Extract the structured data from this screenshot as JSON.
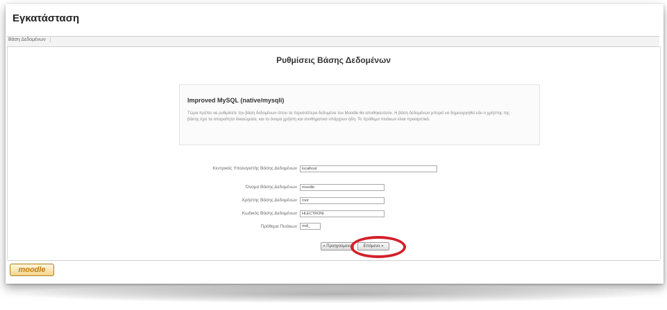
{
  "page": {
    "title": "Εγκατάσταση",
    "breadcrumb": "Βάση Δεδομένων",
    "heading": "Ρυθμίσεις Βάσης Δεδομένων"
  },
  "info": {
    "title": "Improved MySQL (native/mysqli)",
    "text": "Τώρα πρέπει να ρυθμίσετε την βάση δεδομένων όπου τα περισσότερα δεδομένα του Moodle θα αποθηκευτούν. Η βάση δεδομένων μπορεί να δημιουργηθεί εάν ο χρήστης της βάσης έχει τα απαραίτητα δικαιώματα, και το όνομα χρήστη και συνθηματικό υπάρχουν ήδη. Το πρόθεμα πινάκων είναι προαιρετικό."
  },
  "form": {
    "fields": [
      {
        "label": "Κεντρικός Υπολογιστής Βάσης Δεδομένων",
        "value": "localhost"
      },
      {
        "label": "Όνομα Βάσης Δεδομένων",
        "value": "moodle"
      },
      {
        "label": "Χρήστης Βάσης Δεδομένων",
        "value": "root"
      },
      {
        "label": "Κωδικός Βάσης Δεδομένων",
        "value": "HLECTRONI"
      },
      {
        "label": "Πρόθεμα Πινάκων",
        "value": "mdl_"
      }
    ],
    "previous_label": "« Προηγούμενο",
    "next_label": "Επόμενο »"
  },
  "footer": {
    "logo_text": "moodle"
  },
  "colors": {
    "highlight": "#d2202a",
    "logo": "#c9770a"
  }
}
